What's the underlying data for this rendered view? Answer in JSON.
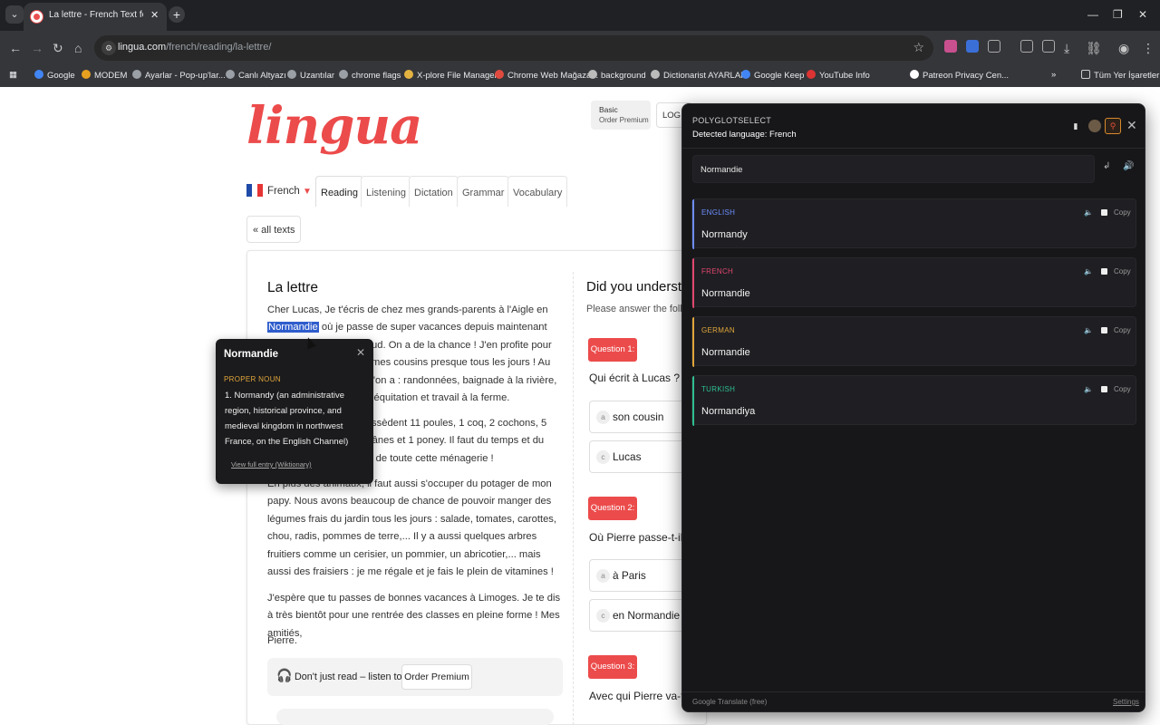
{
  "browser": {
    "tab_title": "La lettre - French Text for Beginners",
    "url_host": "lingua.com",
    "url_path": "/french/reading/la-lettre/",
    "bookmarks": [
      {
        "label": "Google",
        "color": "#4285f4"
      },
      {
        "label": "MODEM",
        "color": "#e6a020"
      },
      {
        "label": "Ayarlar - Pop-up'lar...",
        "color": "#9aa0a6"
      },
      {
        "label": "Canlı Altyazı",
        "color": "#9aa0a6"
      },
      {
        "label": "Uzantılar",
        "color": "#9aa0a6"
      },
      {
        "label": "chrome flags",
        "color": "#9aa0a6"
      },
      {
        "label": "X-plore File Manager",
        "color": "#e3b341"
      },
      {
        "label": "Chrome Web Mağaza...",
        "color": "#e04a3f"
      },
      {
        "label": "background",
        "color": "#bbbbbb"
      },
      {
        "label": "Dictionarist AYARLARI",
        "color": "#bbbbbb"
      },
      {
        "label": "Google Keep",
        "color": "#4285f4"
      },
      {
        "label": "YouTube Info",
        "color": "#d33"
      },
      {
        "label": "Patreon Privacy Cen...",
        "color": "#ffffff"
      }
    ],
    "all_bookmarks": "Tüm Yer İşaretleri"
  },
  "site": {
    "logo": "lingua",
    "plan_label": "Basic",
    "plan_sub": "Order Premium",
    "login": "LOG IN",
    "language": "French",
    "nav": [
      "Reading",
      "Listening",
      "Dictation",
      "Grammar",
      "Vocabulary"
    ],
    "all_texts": "« all texts"
  },
  "article": {
    "title": "La lettre",
    "p1_a": "Cher Lucas, Je t'écris de chez mes grands-parents à l'Aigle en",
    "p1_highlight": "Normandie",
    "p1_b": "où je passe de super vacances depuis maintenant une semaine. Il fait chaud. On a de la chance ! J'en profite pour aller faire du vélo avec mes cousins presque tous les jours ! Au programme, voilà ce qu'on a : randonnées, baignade à la rivière, pêche, jeux de société, équitation et travail à la ferme.",
    "p2": "Mes grands-parents possèdent 11 poules, 1 coq, 2 cochons, 5 moutons, 3 chevaux, 2 ânes et 1 poney. Il faut du temps et du courage pour s'occuper de toute cette ménagerie !",
    "p3": "En plus des animaux, il faut aussi s'occuper du potager de mon papy. Nous avons beaucoup de chance de pouvoir manger des légumes frais du jardin tous les jours : salade, tomates, carottes, chou, radis, pommes de terre,... Il y a aussi quelques arbres fruitiers comme un cerisier, un pommier, un abricotier,... mais aussi des fraisiers : je me régale et je fais le plein de vitamines !",
    "p4": "J'espère que tu passes de bonnes vacances à Limoges. Je te dis à très bientôt pour une rentrée des classes en pleine forme ! Mes amitiés,",
    "p5": "Pierre.",
    "audio_text": "Don't just read – listen too!",
    "audio_button": "Order Premium"
  },
  "quiz": {
    "title": "Did you understand the text?",
    "subtitle": "Please answer the following questions.",
    "questions": [
      {
        "badge": "Question 1:",
        "text": "Qui écrit à Lucas ?",
        "options": [
          {
            "letter": "a",
            "text": "son cousin"
          },
          {
            "letter": "c",
            "text": "Lucas"
          }
        ]
      },
      {
        "badge": "Question 2:",
        "text": "Où Pierre passe-t-il ses vacances ?",
        "options": [
          {
            "letter": "a",
            "text": "à Paris"
          },
          {
            "letter": "c",
            "text": "en Normandie"
          }
        ]
      },
      {
        "badge": "Question 3:",
        "text": "Avec qui Pierre va-t-il faire du vélo ?",
        "options": []
      }
    ]
  },
  "dictionary": {
    "word": "Normandie",
    "pos": "PROPER NOUN",
    "definition": "1. Normandy (an administrative region, historical province, and medieval kingdom in northwest France, on the English Channel)",
    "link": "View full entry (Wiktionary)"
  },
  "panel": {
    "title": "POLYGLOTSELECT",
    "detected": "Detected language: French",
    "input": "Normandie",
    "results": [
      {
        "lang": "ENGLISH",
        "value": "Normandy",
        "color": "#6d8cff"
      },
      {
        "lang": "FRENCH",
        "value": "Normandie",
        "color": "#e0466e"
      },
      {
        "lang": "GERMAN",
        "value": "Normandie",
        "color": "#e0a53a"
      },
      {
        "lang": "TURKISH",
        "value": "Normandiya",
        "color": "#2fbf8f"
      }
    ],
    "copy_label": "Copy",
    "footer": "Google Translate (free)",
    "settings": "Settings"
  }
}
